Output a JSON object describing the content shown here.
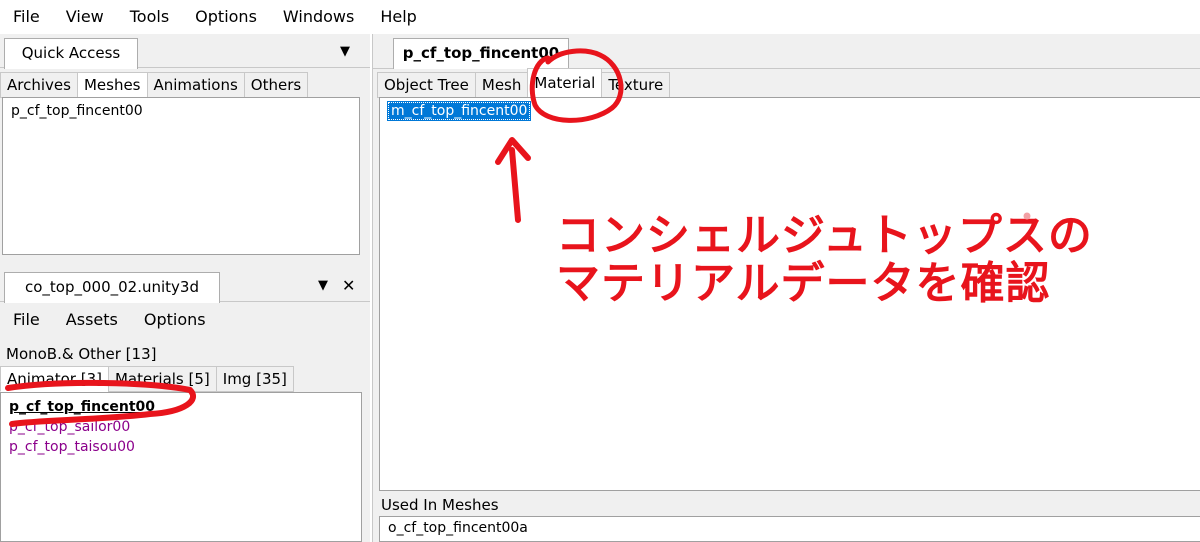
{
  "menubar": [
    "File",
    "View",
    "Tools",
    "Options",
    "Windows",
    "Help"
  ],
  "quick_access": {
    "tab_label": "Quick Access",
    "tabs": [
      "Archives",
      "Meshes",
      "Animations",
      "Others"
    ],
    "active_tab": "Meshes",
    "items": [
      "p_cf_top_fincent00"
    ]
  },
  "asset_panel": {
    "tab_label": "co_top_000_02.unity3d",
    "pin_icon": "▼",
    "close_icon": "✕",
    "menu": [
      "File",
      "Assets",
      "Options"
    ],
    "tabs_row1": [
      "MonoB.& Other [13]"
    ],
    "tabs_row2": [
      "Animator [3]",
      "Materials [5]",
      "Img [35]"
    ],
    "active_tab": "Animator [3]",
    "items": [
      "p_cf_top_fincent00",
      "p_cf_top_sailor00",
      "p_cf_top_taisou00"
    ]
  },
  "document": {
    "tab_label": "p_cf_top_fincent00",
    "tabs": [
      "Object Tree",
      "Mesh",
      "Material",
      "Texture"
    ],
    "active_tab": "Material",
    "materials": [
      "m_cf_top_fincent00"
    ],
    "used_in_label": "Used In Meshes",
    "used_in_items": [
      "o_cf_top_fincent00a"
    ]
  },
  "annotation": {
    "line1": "コンシェルジュトップスの",
    "line2": "マテリアルデータを確認",
    "color": "#e8141c"
  },
  "colors": {
    "selection": "#0078d7",
    "link_purple": "#8b008b",
    "annotation_red": "#e8141c"
  }
}
